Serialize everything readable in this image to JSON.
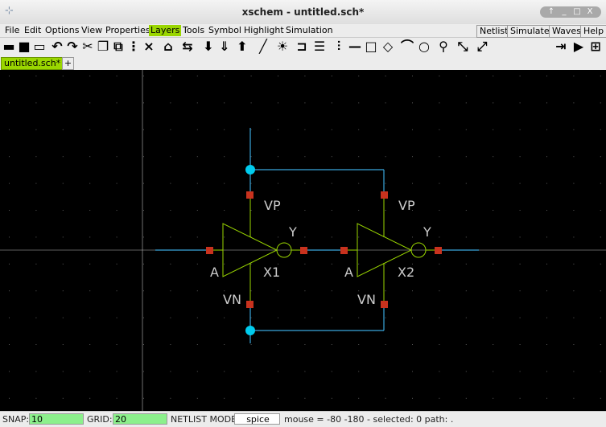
{
  "window": {
    "title": "xschem - untitled.sch*",
    "controls": [
      "↑",
      "_",
      "□",
      "X"
    ]
  },
  "menus": [
    "File",
    "Edit",
    "Options",
    "View",
    "Properties",
    "Layers",
    "Tools",
    "Symbol",
    "Highlight",
    "Simulation"
  ],
  "highlighted_menu": "Layers",
  "right_buttons": [
    "Netlist",
    "Simulate",
    "Waves",
    "Help"
  ],
  "tabs": {
    "active": "untitled.sch*",
    "add": "+"
  },
  "toolbar_icons": [
    "open-icon",
    "save-icon",
    "new-schematic-icon",
    "undo-icon",
    "redo-icon",
    "cut-icon",
    "copy-icon",
    "paste-icon",
    "delete-icon",
    "place-symbol-icon",
    "swap-icon",
    "push-icon",
    "descend-icon",
    "ascend-icon",
    "wire-icon",
    "net-label-icon",
    "pin-icon",
    "bus-icon",
    "text-icon",
    "line-icon",
    "rect-icon",
    "polygon-icon",
    "arc-icon",
    "circle-icon",
    "search-icon",
    "zoom-in-icon",
    "zoom-out-icon",
    "insert-icon",
    "run-icon",
    "waves-icon"
  ],
  "colors": {
    "wire": "#3aa6dc",
    "junction": "#00ccee",
    "symbol": "#9ad600",
    "pin": "#c8321e",
    "text": "#cccccc",
    "highlight": "#9ad600"
  },
  "schematic": {
    "instances": [
      {
        "name": "X1",
        "pin_in": "A",
        "pin_out": "Y",
        "pin_vp": "VP",
        "pin_vn": "VN"
      },
      {
        "name": "X2",
        "pin_in": "A",
        "pin_out": "Y",
        "pin_vp": "VP",
        "pin_vn": "VN"
      }
    ]
  },
  "status": {
    "snap_label": "SNAP:",
    "snap_value": "10",
    "grid_label": "GRID:",
    "grid_value": "20",
    "mode_label": "NETLIST MODE:",
    "mode_value": "spice",
    "info": "mouse = -80 -180 - selected: 0 path: ."
  }
}
